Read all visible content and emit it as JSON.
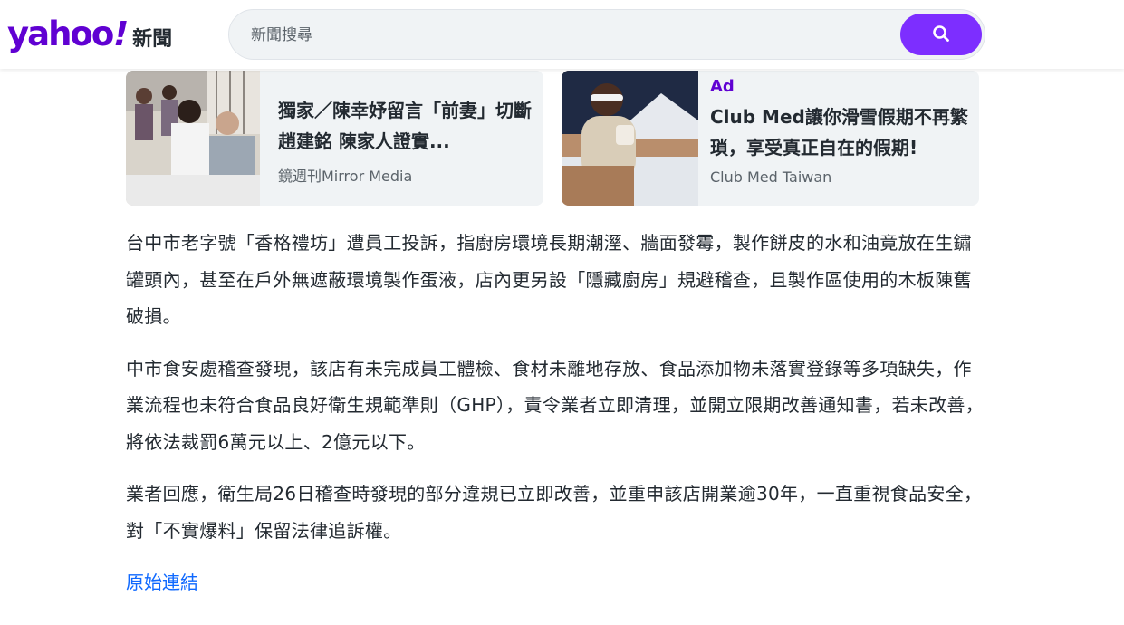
{
  "header": {
    "logo_word": "yahoo",
    "logo_bang": "!",
    "logo_section": "新聞",
    "search_placeholder": "新聞搜尋",
    "search_icon": "search-icon",
    "brand_color": "#6001d2",
    "button_color": "#7d2eff"
  },
  "cards": [
    {
      "title": "獨家／陳幸妤留言「前妻」切斷趙建銘 陳家人證實...",
      "source": "鏡週刊Mirror Media",
      "ad": false
    },
    {
      "ad_label": "Ad",
      "title": "Club Med讓你滑雪假期不再繁瑣，享受真正自在的假期!",
      "source": "Club Med Taiwan",
      "ad": true
    }
  ],
  "article": {
    "paragraphs": [
      "台中市老字號「香格禮坊」遭員工投訴，指廚房環境長期潮溼、牆面發霉，製作餅皮的水和油竟放在生鏽罐頭內，甚至在戶外無遮蔽環境製作蛋液，店內更另設「隱藏廚房」規避稽查，且製作區使用的木板陳舊破損。",
      "中市食安處稽查發現，該店有未完成員工體檢、食材未離地存放、食品添加物未落實登錄等多項缺失，作業流程也未符合食品良好衛生規範準則（GHP），責令業者立即清理，並開立限期改善通知書，若未改善，將依法裁罰6萬元以上、2億元以下。",
      "業者回應，衛生局26日稽查時發現的部分違規已立即改善，並重申該店開業逾30年，一直重視食品安全，對「不實爆料」保留法律追訴權。"
    ],
    "original_link": "原始連結",
    "link_color": "#0f69ff"
  }
}
